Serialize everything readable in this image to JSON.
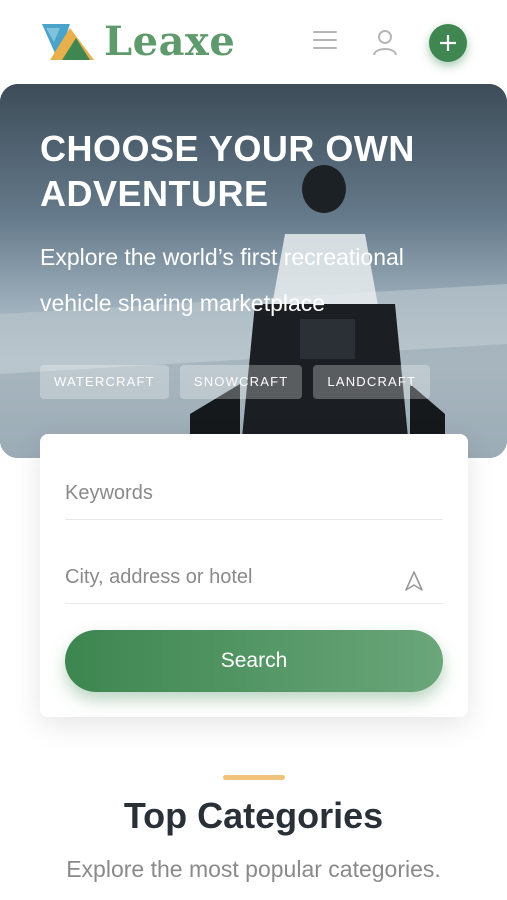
{
  "brand": {
    "name": "Leaxe",
    "color": "#5e9a6c"
  },
  "header": {
    "menu_icon": "hamburger-menu-icon",
    "user_icon": "user-icon",
    "add_icon": "plus-icon",
    "accent": "#3f8651"
  },
  "hero": {
    "title": "CHOOSE YOUR OWN ADVENTURE",
    "subtitle": "Explore the world’s first recreational vehicle sharing marketplace",
    "tags": [
      "WATERCRAFT",
      "SNOWCRAFT",
      "LANDCRAFT"
    ]
  },
  "search": {
    "keywords_placeholder": "Keywords",
    "location_placeholder": "City, address or hotel",
    "location_icon": "navigation-arrow-icon",
    "button_label": "Search",
    "button_color": "#3d8650"
  },
  "categories": {
    "title": "Top Categories",
    "subtitle": "Explore the most popular categories.",
    "accent_color": "#f2c37a"
  }
}
